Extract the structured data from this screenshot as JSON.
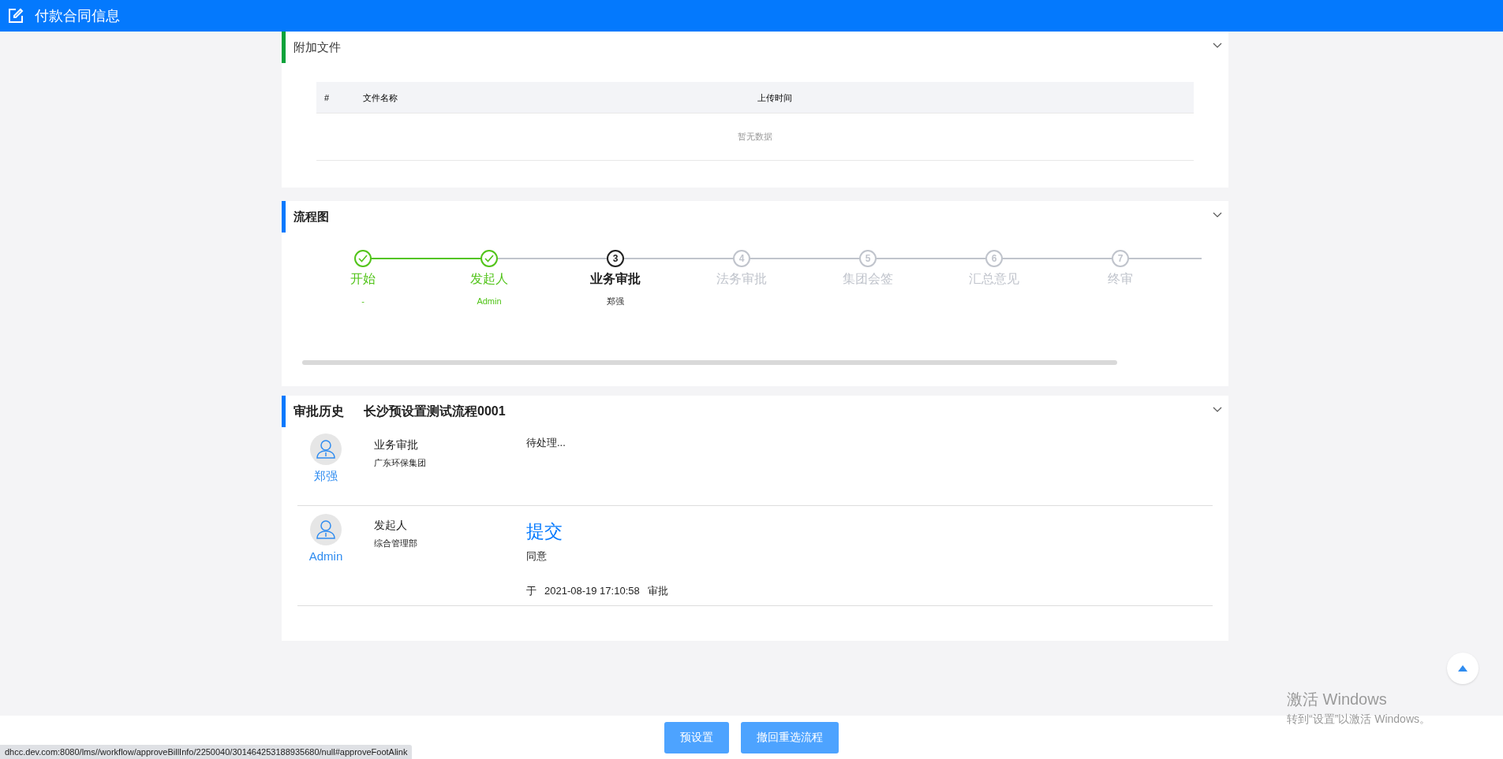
{
  "header": {
    "title": "付款合同信息"
  },
  "attachments": {
    "title": "附加文件",
    "expanded": true,
    "columns": [
      "#",
      "文件名称",
      "上传时间"
    ],
    "empty_text": "暂无数据"
  },
  "flow": {
    "title": "流程图",
    "expanded": true,
    "steps": [
      {
        "label": "开始",
        "person": "-",
        "done": true,
        "current": false
      },
      {
        "label": "发起人",
        "person": "Admin",
        "done": true,
        "current": false
      },
      {
        "number": "3",
        "label": "业务审批",
        "person": "郑强",
        "done": false,
        "current": true
      },
      {
        "number": "4",
        "label": "法务审批",
        "done": false,
        "current": false
      },
      {
        "number": "5",
        "label": "集团会签",
        "done": false,
        "current": false
      },
      {
        "number": "6",
        "label": "汇总意见",
        "done": false,
        "current": false
      },
      {
        "number": "7",
        "label": "终审",
        "done": false,
        "current": false
      }
    ]
  },
  "history": {
    "title": "审批历史",
    "process_name": "长沙预设置测试流程0001",
    "expanded": true,
    "entries": [
      {
        "user": "郑强",
        "node": "业务审批",
        "department": "广东环保集团",
        "status_text": "待处理..."
      },
      {
        "user": "Admin",
        "node": "发起人",
        "department": "综合管理部",
        "action": "提交",
        "comment": "同意",
        "time_prefix": "于",
        "time": "2021-08-19 17:10:58",
        "time_suffix": "审批"
      }
    ]
  },
  "footer_buttons": [
    "预设置",
    "撤回重选流程"
  ],
  "status_url": "dhcc.dev.com:8080/lms//workflow/approveBillInfo/2250040/301464253188935680/null#approveFootAlink",
  "activation": {
    "title": "激活 Windows",
    "subtitle": "转到“设置”以激活 Windows。"
  }
}
